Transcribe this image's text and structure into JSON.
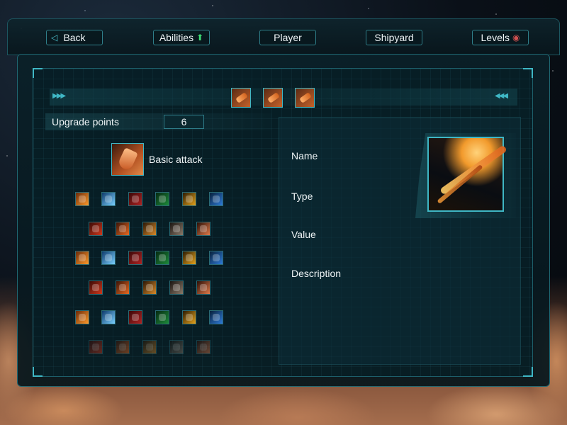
{
  "nav": {
    "back_label": "Back",
    "abilities_label": "Abilities",
    "player_label": "Player",
    "shipyard_label": "Shipyard",
    "levels_label": "Levels"
  },
  "upgrade": {
    "label": "Upgrade points",
    "value": "6"
  },
  "selected_skill": {
    "name": "Basic attack"
  },
  "details": {
    "name_label": "Name",
    "type_label": "Type",
    "value_label": "Value",
    "description_label": "Description"
  },
  "tabs": [
    "basic-attack-tab",
    "laser-tab",
    "missile-tab"
  ],
  "skill_rows": [
    [
      "fire-shot",
      "ice-bolt",
      "red-rune",
      "green-shield",
      "cross-star",
      "blue-ring"
    ],
    [
      "red-swirl",
      "fire-burst",
      "hammer-strike",
      "blade-slash",
      "mushroom-cloud"
    ],
    [
      "fire-shot",
      "ice-bolt",
      "red-rune",
      "green-shield",
      "cross-star",
      "blue-ring"
    ],
    [
      "red-swirl",
      "fire-burst",
      "hammer-strike",
      "blade-slash",
      "mushroom-cloud"
    ],
    [
      "fire-shot",
      "ice-bolt",
      "red-rune",
      "green-shield",
      "cross-star",
      "blue-ring"
    ],
    [
      "red-swirl",
      "fire-burst",
      "hammer-strike",
      "blade-slash",
      "mushroom-cloud"
    ]
  ],
  "colors": {
    "accent": "#3fb7c5",
    "panel": "#0a2028"
  }
}
